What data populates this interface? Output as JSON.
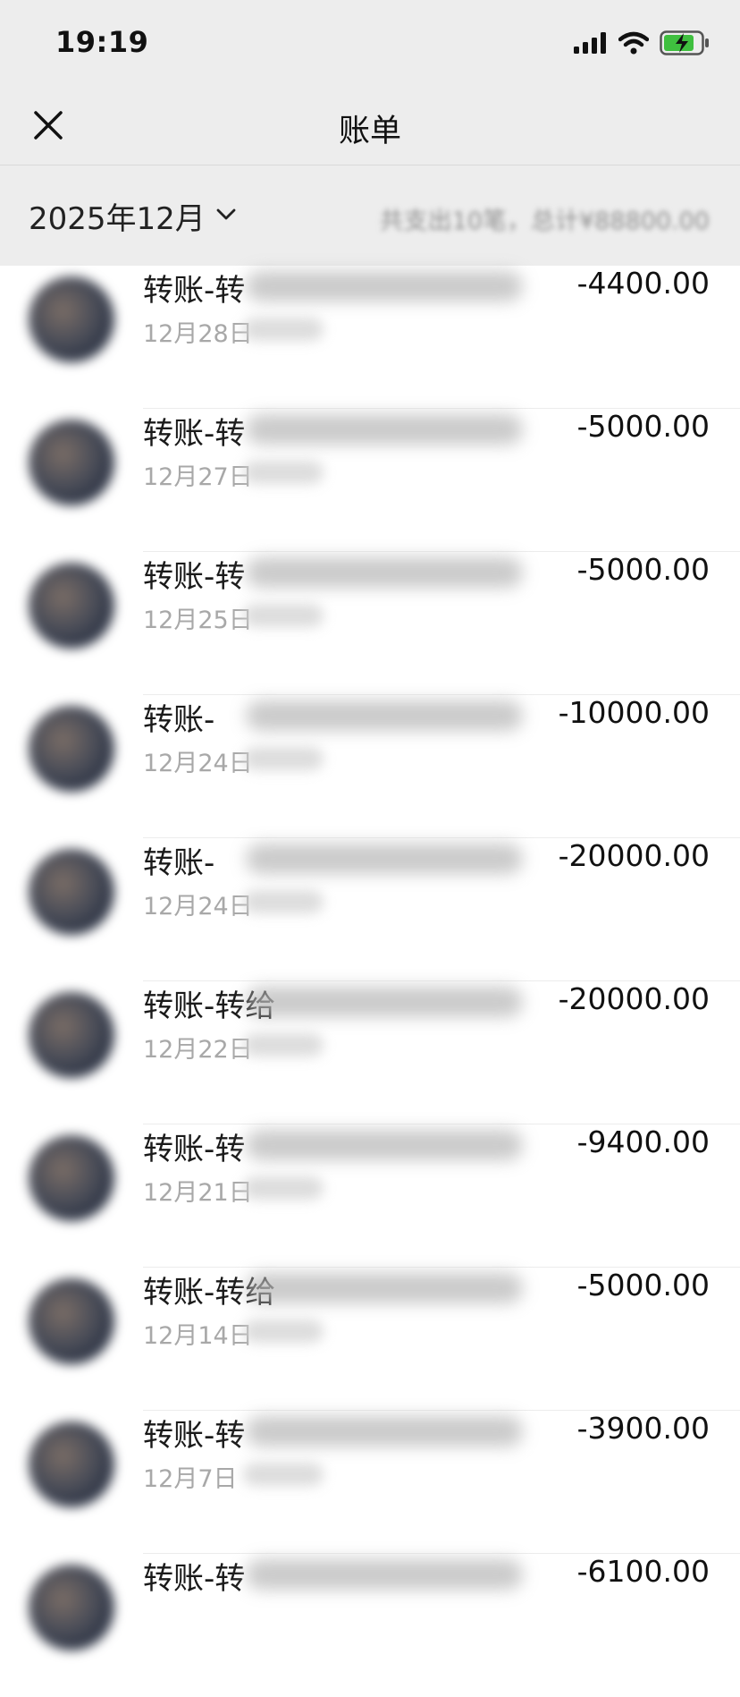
{
  "status_bar": {
    "time": "19:19",
    "icons": [
      "cellular-signal-icon",
      "wifi-icon",
      "battery-charging-icon"
    ],
    "battery_color": "#3fbf3f"
  },
  "nav": {
    "title": "账单",
    "close_icon": "close-icon"
  },
  "month_header": {
    "month_label": "2025年12月",
    "dropdown_icon": "chevron-down-icon",
    "summary": "共支出10笔，总计¥88800.00"
  },
  "transactions": [
    {
      "title": "转账-转",
      "date": "12月28日",
      "amount": "-4400.00"
    },
    {
      "title": "转账-转",
      "date": "12月27日",
      "amount": "-5000.00"
    },
    {
      "title": "转账-转",
      "date": "12月25日",
      "amount": "-5000.00"
    },
    {
      "title": "转账-",
      "date": "12月24日",
      "amount": "-10000.00"
    },
    {
      "title": "转账-",
      "date": "12月24日",
      "amount": "-20000.00"
    },
    {
      "title": "转账-转给",
      "date": "12月22日",
      "amount": "-20000.00"
    },
    {
      "title": "转账-转",
      "date": "12月21日",
      "amount": "-9400.00"
    },
    {
      "title": "转账-转给",
      "date": "12月14日",
      "amount": "-5000.00"
    },
    {
      "title": "转账-转",
      "date": "12月7日",
      "amount": "-3900.00"
    },
    {
      "title": "转账-转",
      "date": "",
      "amount": "-6100.00"
    }
  ]
}
